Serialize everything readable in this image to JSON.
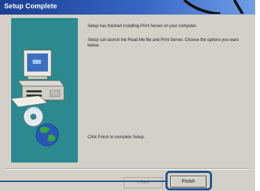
{
  "window": {
    "title": "Setup Complete"
  },
  "content": {
    "line1": "Setup has finished installing Print Server on your computer.",
    "line2": "Setup can launch the Read Me file and Print Server. Choose the options you want below.",
    "line3": "Click Finish to complete Setup."
  },
  "buttons": {
    "back_label": "< Back",
    "finish_label": "Finish"
  },
  "colors": {
    "titlebar": "#1c3f92",
    "panel": "#2b8a8f",
    "dialog": "#d4d0c8",
    "highlight": "#1e4f8c"
  },
  "icons": [
    "computer-icon",
    "cd-disc-icon",
    "globe-icon"
  ]
}
